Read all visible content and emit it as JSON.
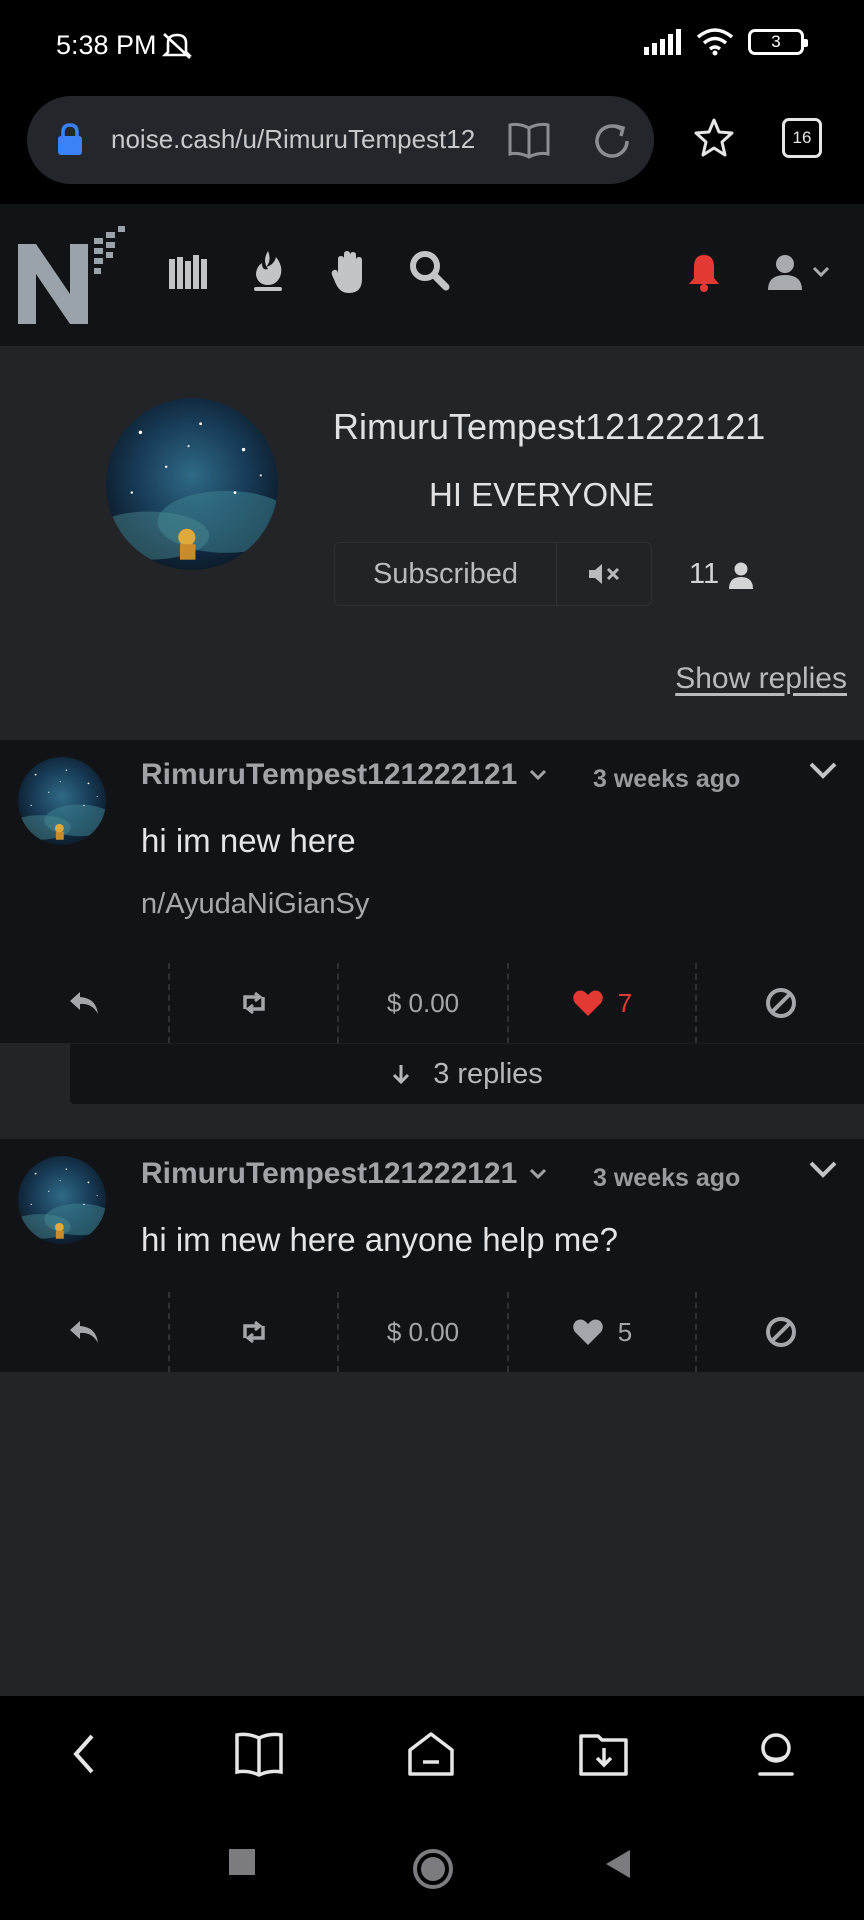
{
  "status_bar": {
    "time": "5:38 PM",
    "battery": "3",
    "icons": [
      "alarm-off-icon",
      "signal-icon",
      "wifi-icon",
      "battery-icon"
    ]
  },
  "browser": {
    "url": "noise.cash/u/RimuruTempest12",
    "tab_count": "16",
    "icons": [
      "lock-icon",
      "reader-mode-icon",
      "reload-icon",
      "star-icon",
      "tabs-icon"
    ]
  },
  "site_header": {
    "logo_text": "N",
    "nav_icons": [
      "library-icon",
      "fire-icon",
      "hand-icon",
      "search-icon"
    ],
    "colors": {
      "bell": "#e53935",
      "logo": "#9aa3aa"
    }
  },
  "profile": {
    "username": "RimuruTempest121222121",
    "bio": "HI EVERYONE",
    "subscribe_label": "Subscribed",
    "subscriber_count": "11",
    "show_replies_label": "Show replies"
  },
  "posts": [
    {
      "author": "RimuruTempest121222121",
      "time": "3 weeks ago",
      "text": "hi im new here",
      "channel_prefix": "n/",
      "channel": "AyudaNiGianSy",
      "tip": "$ 0.00",
      "likes": "7",
      "liked": true,
      "replies_label": "3 replies"
    },
    {
      "author": "RimuruTempest121222121",
      "time": "3 weeks ago",
      "text": "hi im new here anyone help me?",
      "tip": "$ 0.00",
      "likes": "5",
      "liked": false
    }
  ],
  "bottom_bar": {
    "icons": [
      "back-icon",
      "bookmarks-icon",
      "home-icon",
      "downloads-icon",
      "profile-icon"
    ]
  },
  "system_nav": {
    "icons": [
      "recents-icon",
      "home-button-icon",
      "back-triangle-icon"
    ]
  }
}
